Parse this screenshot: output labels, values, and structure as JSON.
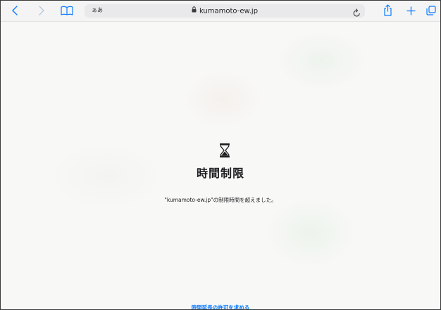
{
  "toolbar": {
    "back_icon": "chevron-left-icon",
    "forward_icon": "chevron-right-icon",
    "bookmarks_icon": "book-icon",
    "reader_label": "ぁあ",
    "url": "kumamoto-ew.jp",
    "reload_icon": "reload-icon",
    "share_icon": "share-icon",
    "new_tab_icon": "plus-icon",
    "tabs_icon": "tabs-icon",
    "accent_color": "#0a7aff"
  },
  "main": {
    "icon": "hourglass-icon",
    "title": "時間制限",
    "message": "\"kumamoto-ew.jp\"の制限時間を超えました。",
    "request_link": "時間延長の許可を求める"
  }
}
